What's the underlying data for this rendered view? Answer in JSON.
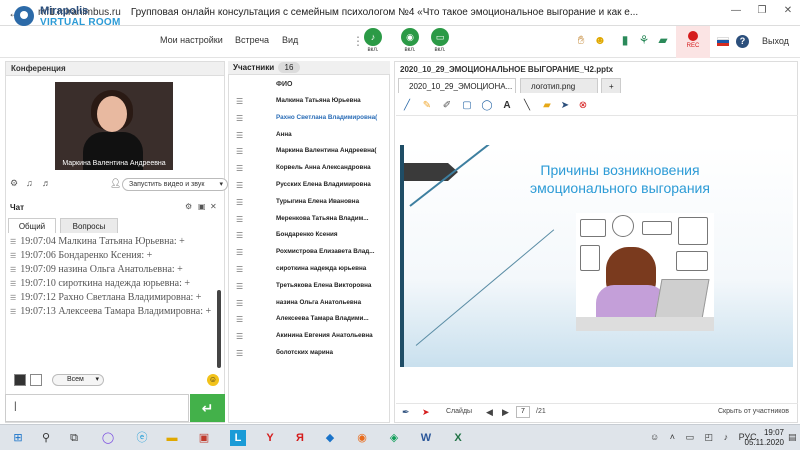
{
  "browser": {
    "url": "mf1.miranimbus.ru",
    "page_title": "Групповая онлайн консультация с семейным психологом №4 «Что такое эмоциональное выгорание и как е...",
    "window_controls": [
      "—",
      "❐",
      "✕"
    ]
  },
  "app": {
    "logo_line1": "Mirapolis",
    "logo_line2": "VIRTUAL ROOM",
    "menu": [
      "Мои настройки",
      "Встреча",
      "Вид"
    ],
    "mic_label": "вкл.",
    "cam_label": "вкл.",
    "screen_label": "вкл.",
    "rec_label": "REC",
    "exit_label": "Выход",
    "help_label": "?",
    "accent": "#2b9a46",
    "brand": "#2c4f7c"
  },
  "conference": {
    "title": "Конференция",
    "video_name": "Маркина Валентина Андреевна",
    "start_video_button": "Запустить видео и звук"
  },
  "chat": {
    "title": "Чат",
    "tabs": [
      "Общий",
      "Вопросы"
    ],
    "messages": [
      "19:07:04  Малкина Татьяна  Юрьевна: +",
      "19:07:06  Бондаренко  Ксения: +",
      "19:07:09  назина  Ольга Анатольевна: +",
      "19:07:10  сироткина  надежда  юрьевна: +",
      "19:07:12  Рахно Светлана  Владимировна: +",
      "19:07:13  Алексеева   Тамара  Владимировна: +"
    ],
    "recipient": "Всем",
    "input_value": "|",
    "send_label": "↵"
  },
  "participants": {
    "title": "Участники",
    "count": "16",
    "column_header": "ФИО",
    "list": [
      {
        "name": "Малкина Татьяна  Юрьевна",
        "highlight": false
      },
      {
        "name": "Рахно Светлана  Владимировна(",
        "highlight": true
      },
      {
        "name": "Анна",
        "highlight": false
      },
      {
        "name": "Маркина Валентина  Андреевна(",
        "highlight": false
      },
      {
        "name": "Корвель Анна  Александровна",
        "highlight": false
      },
      {
        "name": "Русских Елена Владимировна",
        "highlight": false
      },
      {
        "name": "Турыгина  Елена  Ивановна",
        "highlight": false
      },
      {
        "name": "Меренкова  Татьяна  Владим...",
        "highlight": false
      },
      {
        "name": "Бондаренко  Ксения",
        "highlight": false
      },
      {
        "name": "Рохмистрова  Елизавета Влад...",
        "highlight": false
      },
      {
        "name": "сироткина  надежда  юрьевна",
        "highlight": false
      },
      {
        "name": "Третьякова  Елена Викторовна",
        "highlight": false
      },
      {
        "name": "назина  Ольга Анатольевна",
        "highlight": false
      },
      {
        "name": "Алексеева   Тамара  Владими...",
        "highlight": false
      },
      {
        "name": "Акинина  Евгения  Анатольевна",
        "highlight": false
      },
      {
        "name": "болотских  марина",
        "highlight": false
      }
    ]
  },
  "presentation": {
    "file_title": "2020_10_29_ЭМОЦИОНАЛЬНОЕ ВЫГОРАНИЕ_Ч2.pptx",
    "tabs": [
      "2020_10_29_ЭМОЦИОНА...",
      "логотип.png",
      "+"
    ],
    "slide_title_line1": "Причины возникновения",
    "slide_title_line2": "эмоционального выгорания",
    "slides_label": "Слайды",
    "current_page": "7",
    "total_pages": "/21",
    "hide_label": "Скрыть от участников"
  },
  "taskbar": {
    "language": "РУС",
    "time": "19:07",
    "date": "05.11.2020"
  }
}
